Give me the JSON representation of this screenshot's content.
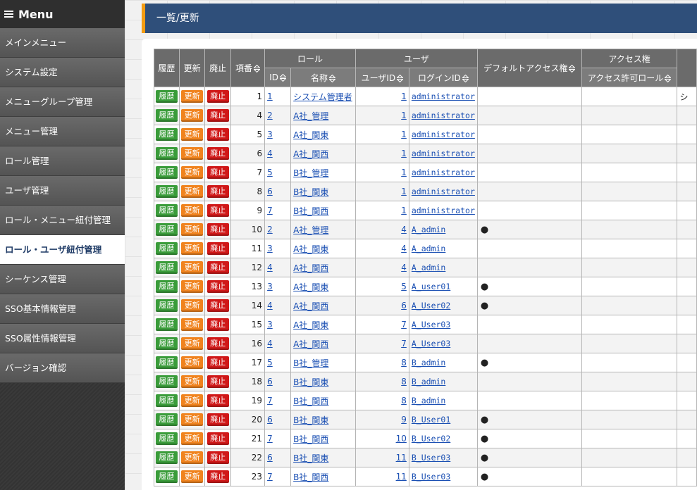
{
  "sidebar": {
    "title": "Menu",
    "items": [
      {
        "label": "メインメニュー"
      },
      {
        "label": "システム設定"
      },
      {
        "label": "メニューグループ管理"
      },
      {
        "label": "メニュー管理"
      },
      {
        "label": "ロール管理"
      },
      {
        "label": "ユーザ管理"
      },
      {
        "label": "ロール・メニュー紐付管理"
      },
      {
        "label": "ロール・ユーザ紐付管理",
        "active": true
      },
      {
        "label": "シーケンス管理"
      },
      {
        "label": "SSO基本情報管理"
      },
      {
        "label": "SSO属性情報管理"
      },
      {
        "label": "バージョン確認"
      }
    ]
  },
  "page": {
    "title": "一覧/更新"
  },
  "table": {
    "headers": {
      "history": "履歴",
      "update": "更新",
      "abolish": "廃止",
      "item_no": "項番",
      "role_group": "ロール",
      "role_id": "ID",
      "role_name": "名称",
      "user_group": "ユーザ",
      "user_id": "ユーザID",
      "login_id": "ログインID",
      "default_access": "デフォルトアクセス権",
      "access_group": "アクセス権",
      "access_role": "アクセス許可ロール"
    },
    "buttons": {
      "history": "履歴",
      "update": "更新",
      "abolish": "廃止"
    },
    "rows": [
      {
        "no": "1",
        "role_id": "1",
        "role_name": "システム管理者",
        "user_id": "1",
        "login_id": "administrator",
        "default": "",
        "extra": "シ"
      },
      {
        "no": "4",
        "role_id": "2",
        "role_name": "A社_管理",
        "user_id": "1",
        "login_id": "administrator",
        "default": "",
        "extra": ""
      },
      {
        "no": "5",
        "role_id": "3",
        "role_name": "A社_関東",
        "user_id": "1",
        "login_id": "administrator",
        "default": "",
        "extra": ""
      },
      {
        "no": "6",
        "role_id": "4",
        "role_name": "A社_関西",
        "user_id": "1",
        "login_id": "administrator",
        "default": "",
        "extra": ""
      },
      {
        "no": "7",
        "role_id": "5",
        "role_name": "B社_管理",
        "user_id": "1",
        "login_id": "administrator",
        "default": "",
        "extra": ""
      },
      {
        "no": "8",
        "role_id": "6",
        "role_name": "B社_関東",
        "user_id": "1",
        "login_id": "administrator",
        "default": "",
        "extra": ""
      },
      {
        "no": "9",
        "role_id": "7",
        "role_name": "B社_関西",
        "user_id": "1",
        "login_id": "administrator",
        "default": "",
        "extra": ""
      },
      {
        "no": "10",
        "role_id": "2",
        "role_name": "A社_管理",
        "user_id": "4",
        "login_id": "A_admin",
        "default": "●",
        "extra": ""
      },
      {
        "no": "11",
        "role_id": "3",
        "role_name": "A社_関東",
        "user_id": "4",
        "login_id": "A_admin",
        "default": "",
        "extra": ""
      },
      {
        "no": "12",
        "role_id": "4",
        "role_name": "A社_関西",
        "user_id": "4",
        "login_id": "A_admin",
        "default": "",
        "extra": ""
      },
      {
        "no": "13",
        "role_id": "3",
        "role_name": "A社_関東",
        "user_id": "5",
        "login_id": "A_user01",
        "default": "●",
        "extra": ""
      },
      {
        "no": "14",
        "role_id": "4",
        "role_name": "A社_関西",
        "user_id": "6",
        "login_id": "A_User02",
        "default": "●",
        "extra": ""
      },
      {
        "no": "15",
        "role_id": "3",
        "role_name": "A社_関東",
        "user_id": "7",
        "login_id": "A_User03",
        "default": "",
        "extra": ""
      },
      {
        "no": "16",
        "role_id": "4",
        "role_name": "A社_関西",
        "user_id": "7",
        "login_id": "A_User03",
        "default": "",
        "extra": ""
      },
      {
        "no": "17",
        "role_id": "5",
        "role_name": "B社_管理",
        "user_id": "8",
        "login_id": "B_admin",
        "default": "●",
        "extra": ""
      },
      {
        "no": "18",
        "role_id": "6",
        "role_name": "B社_関東",
        "user_id": "8",
        "login_id": "B_admin",
        "default": "",
        "extra": ""
      },
      {
        "no": "19",
        "role_id": "7",
        "role_name": "B社_関西",
        "user_id": "8",
        "login_id": "B_admin",
        "default": "",
        "extra": ""
      },
      {
        "no": "20",
        "role_id": "6",
        "role_name": "B社_関東",
        "user_id": "9",
        "login_id": "B_User01",
        "default": "●",
        "extra": ""
      },
      {
        "no": "21",
        "role_id": "7",
        "role_name": "B社_関西",
        "user_id": "10",
        "login_id": "B_User02",
        "default": "●",
        "extra": ""
      },
      {
        "no": "22",
        "role_id": "6",
        "role_name": "B社_関東",
        "user_id": "11",
        "login_id": "B_User03",
        "default": "●",
        "extra": ""
      },
      {
        "no": "23",
        "role_id": "7",
        "role_name": "B社_関西",
        "user_id": "11",
        "login_id": "B_User03",
        "default": "●",
        "extra": ""
      }
    ]
  },
  "colors": {
    "title_bar": "#2f4f7a",
    "title_accent": "#f39c12",
    "history_button": "#3a9c3a",
    "update_button": "#f0831e",
    "abolish_button": "#d01818",
    "link": "#1a4fb3"
  }
}
